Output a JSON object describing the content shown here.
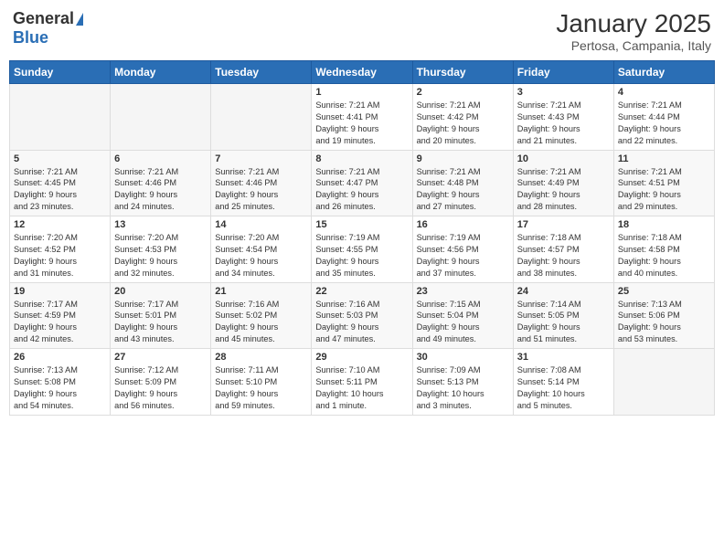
{
  "header": {
    "logo_general": "General",
    "logo_blue": "Blue",
    "title": "January 2025",
    "subtitle": "Pertosa, Campania, Italy"
  },
  "days_of_week": [
    "Sunday",
    "Monday",
    "Tuesday",
    "Wednesday",
    "Thursday",
    "Friday",
    "Saturday"
  ],
  "weeks": [
    [
      {
        "day": "",
        "info": ""
      },
      {
        "day": "",
        "info": ""
      },
      {
        "day": "",
        "info": ""
      },
      {
        "day": "1",
        "info": "Sunrise: 7:21 AM\nSunset: 4:41 PM\nDaylight: 9 hours\nand 19 minutes."
      },
      {
        "day": "2",
        "info": "Sunrise: 7:21 AM\nSunset: 4:42 PM\nDaylight: 9 hours\nand 20 minutes."
      },
      {
        "day": "3",
        "info": "Sunrise: 7:21 AM\nSunset: 4:43 PM\nDaylight: 9 hours\nand 21 minutes."
      },
      {
        "day": "4",
        "info": "Sunrise: 7:21 AM\nSunset: 4:44 PM\nDaylight: 9 hours\nand 22 minutes."
      }
    ],
    [
      {
        "day": "5",
        "info": "Sunrise: 7:21 AM\nSunset: 4:45 PM\nDaylight: 9 hours\nand 23 minutes."
      },
      {
        "day": "6",
        "info": "Sunrise: 7:21 AM\nSunset: 4:46 PM\nDaylight: 9 hours\nand 24 minutes."
      },
      {
        "day": "7",
        "info": "Sunrise: 7:21 AM\nSunset: 4:46 PM\nDaylight: 9 hours\nand 25 minutes."
      },
      {
        "day": "8",
        "info": "Sunrise: 7:21 AM\nSunset: 4:47 PM\nDaylight: 9 hours\nand 26 minutes."
      },
      {
        "day": "9",
        "info": "Sunrise: 7:21 AM\nSunset: 4:48 PM\nDaylight: 9 hours\nand 27 minutes."
      },
      {
        "day": "10",
        "info": "Sunrise: 7:21 AM\nSunset: 4:49 PM\nDaylight: 9 hours\nand 28 minutes."
      },
      {
        "day": "11",
        "info": "Sunrise: 7:21 AM\nSunset: 4:51 PM\nDaylight: 9 hours\nand 29 minutes."
      }
    ],
    [
      {
        "day": "12",
        "info": "Sunrise: 7:20 AM\nSunset: 4:52 PM\nDaylight: 9 hours\nand 31 minutes."
      },
      {
        "day": "13",
        "info": "Sunrise: 7:20 AM\nSunset: 4:53 PM\nDaylight: 9 hours\nand 32 minutes."
      },
      {
        "day": "14",
        "info": "Sunrise: 7:20 AM\nSunset: 4:54 PM\nDaylight: 9 hours\nand 34 minutes."
      },
      {
        "day": "15",
        "info": "Sunrise: 7:19 AM\nSunset: 4:55 PM\nDaylight: 9 hours\nand 35 minutes."
      },
      {
        "day": "16",
        "info": "Sunrise: 7:19 AM\nSunset: 4:56 PM\nDaylight: 9 hours\nand 37 minutes."
      },
      {
        "day": "17",
        "info": "Sunrise: 7:18 AM\nSunset: 4:57 PM\nDaylight: 9 hours\nand 38 minutes."
      },
      {
        "day": "18",
        "info": "Sunrise: 7:18 AM\nSunset: 4:58 PM\nDaylight: 9 hours\nand 40 minutes."
      }
    ],
    [
      {
        "day": "19",
        "info": "Sunrise: 7:17 AM\nSunset: 4:59 PM\nDaylight: 9 hours\nand 42 minutes."
      },
      {
        "day": "20",
        "info": "Sunrise: 7:17 AM\nSunset: 5:01 PM\nDaylight: 9 hours\nand 43 minutes."
      },
      {
        "day": "21",
        "info": "Sunrise: 7:16 AM\nSunset: 5:02 PM\nDaylight: 9 hours\nand 45 minutes."
      },
      {
        "day": "22",
        "info": "Sunrise: 7:16 AM\nSunset: 5:03 PM\nDaylight: 9 hours\nand 47 minutes."
      },
      {
        "day": "23",
        "info": "Sunrise: 7:15 AM\nSunset: 5:04 PM\nDaylight: 9 hours\nand 49 minutes."
      },
      {
        "day": "24",
        "info": "Sunrise: 7:14 AM\nSunset: 5:05 PM\nDaylight: 9 hours\nand 51 minutes."
      },
      {
        "day": "25",
        "info": "Sunrise: 7:13 AM\nSunset: 5:06 PM\nDaylight: 9 hours\nand 53 minutes."
      }
    ],
    [
      {
        "day": "26",
        "info": "Sunrise: 7:13 AM\nSunset: 5:08 PM\nDaylight: 9 hours\nand 54 minutes."
      },
      {
        "day": "27",
        "info": "Sunrise: 7:12 AM\nSunset: 5:09 PM\nDaylight: 9 hours\nand 56 minutes."
      },
      {
        "day": "28",
        "info": "Sunrise: 7:11 AM\nSunset: 5:10 PM\nDaylight: 9 hours\nand 59 minutes."
      },
      {
        "day": "29",
        "info": "Sunrise: 7:10 AM\nSunset: 5:11 PM\nDaylight: 10 hours\nand 1 minute."
      },
      {
        "day": "30",
        "info": "Sunrise: 7:09 AM\nSunset: 5:13 PM\nDaylight: 10 hours\nand 3 minutes."
      },
      {
        "day": "31",
        "info": "Sunrise: 7:08 AM\nSunset: 5:14 PM\nDaylight: 10 hours\nand 5 minutes."
      },
      {
        "day": "",
        "info": ""
      }
    ]
  ]
}
